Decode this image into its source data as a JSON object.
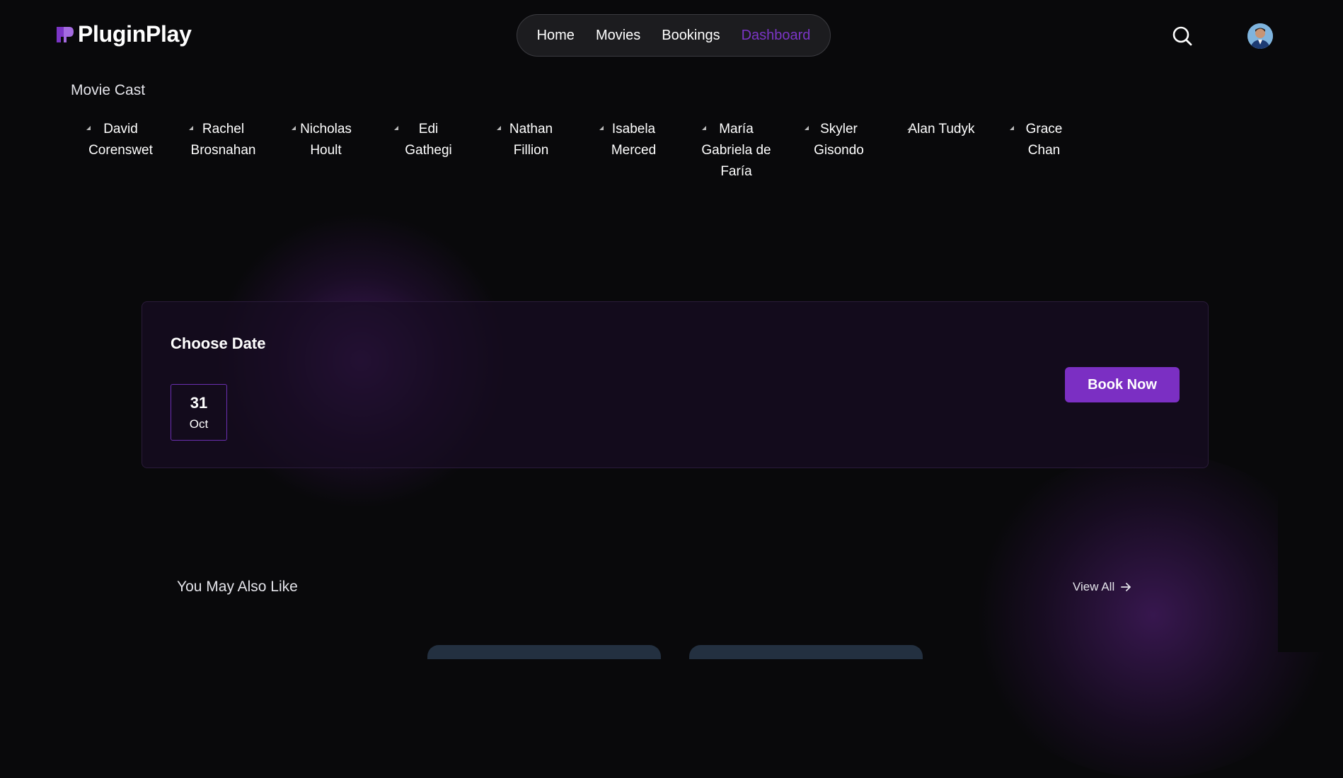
{
  "header": {
    "logo_text": "PluginPlay",
    "nav": [
      {
        "label": "Home",
        "active": false
      },
      {
        "label": "Movies",
        "active": false
      },
      {
        "label": "Bookings",
        "active": false
      },
      {
        "label": "Dashboard",
        "active": true
      }
    ],
    "search_icon": "search-icon",
    "accent_color": "#7b35c6"
  },
  "cast": {
    "title": "Movie Cast",
    "members": [
      {
        "line1": "David",
        "line2": "Corenswet",
        "line3": ""
      },
      {
        "line1": "Rachel",
        "line2": "Brosnahan",
        "line3": ""
      },
      {
        "line1": "Nicholas",
        "line2": "Hoult",
        "line3": ""
      },
      {
        "line1": "Edi",
        "line2": "Gathegi",
        "line3": ""
      },
      {
        "line1": "Nathan",
        "line2": "Fillion",
        "line3": ""
      },
      {
        "line1": "Isabela",
        "line2": "Merced",
        "line3": ""
      },
      {
        "line1": "María",
        "line2": "Gabriela de",
        "line3": "Faría"
      },
      {
        "line1": "Skyler",
        "line2": "Gisondo",
        "line3": ""
      },
      {
        "line1": "Alan Tudyk",
        "line2": "",
        "line3": ""
      },
      {
        "line1": "Grace",
        "line2": "Chan",
        "line3": ""
      }
    ]
  },
  "booking": {
    "title": "Choose Date",
    "date": {
      "day": "31",
      "month": "Oct"
    },
    "button_label": "Book Now"
  },
  "recommendations": {
    "title": "You May Also Like",
    "view_all_label": "View All"
  }
}
